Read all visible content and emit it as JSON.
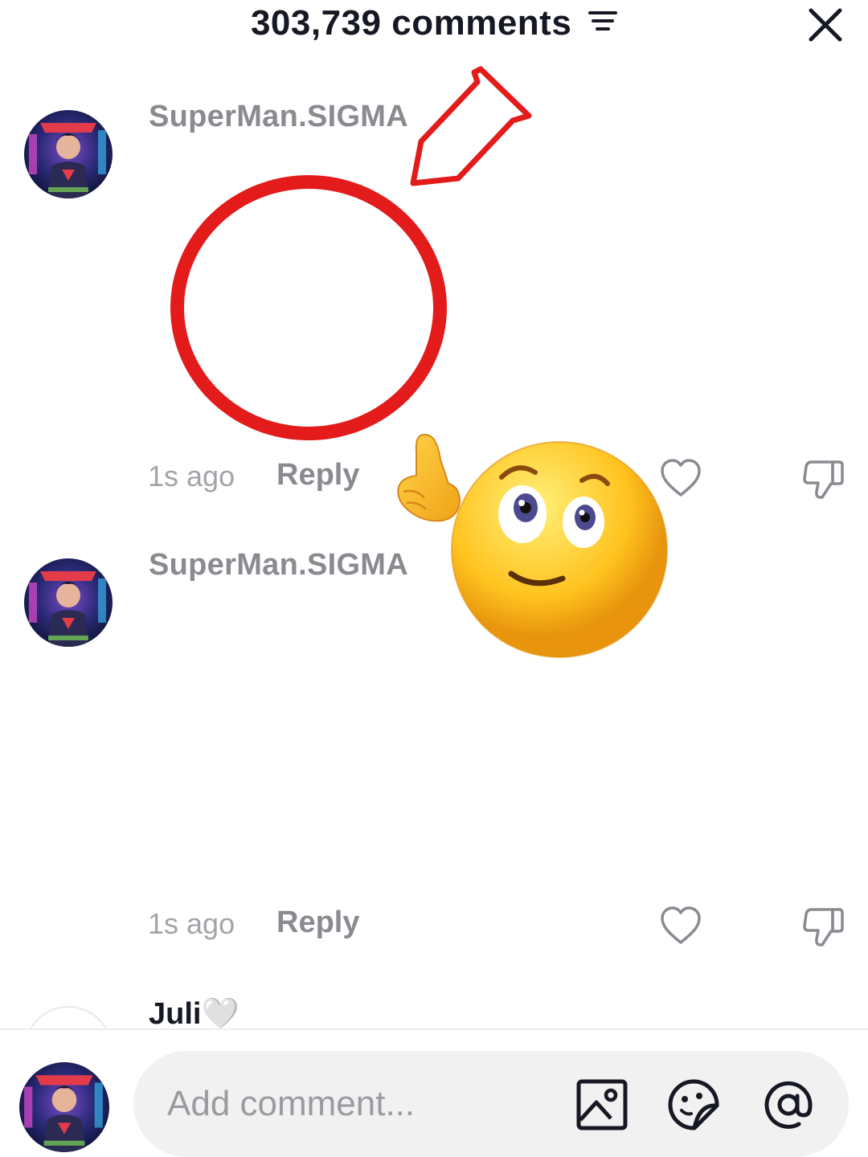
{
  "header": {
    "comment_count_label": "303,739 comments",
    "icons": {
      "filter": "filter-lines-icon",
      "close": "close-x-icon"
    }
  },
  "comments": [
    {
      "username": "SuperMan.SIGMA",
      "time": "1s ago",
      "reply_label": "Reply",
      "icons": {
        "like": "heart-outline-icon",
        "dislike": "thumbs-down-icon"
      }
    },
    {
      "username": "SuperMan.SIGMA",
      "time": "1s ago",
      "reply_label": "Reply",
      "icons": {
        "like": "heart-outline-icon",
        "dislike": "thumbs-down-icon"
      }
    },
    {
      "username": "Juli🤍"
    }
  ],
  "overlays": {
    "annotation_color": "#e31b1b",
    "emoji": "pointing-up-smiley-emoji"
  },
  "composer": {
    "placeholder": "Add comment...",
    "icons": {
      "image": "image-icon",
      "sticker": "sticker-icon",
      "mention": "at-mention-icon"
    }
  }
}
